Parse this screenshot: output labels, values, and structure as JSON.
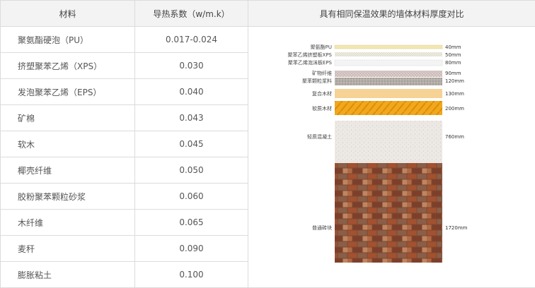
{
  "headers": {
    "material": "材料",
    "conductivity": "导热系数（w/m.k）",
    "comparison": "具有相同保温效果的墙体材料厚度对比"
  },
  "rows": [
    {
      "material": "聚氨酯硬泡（PU）",
      "value": "0.017-0.024"
    },
    {
      "material": "挤塑聚苯乙烯（XPS）",
      "value": "0.030"
    },
    {
      "material": "发泡聚苯乙烯（EPS）",
      "value": "0.040"
    },
    {
      "material": "矿棉",
      "value": "0.043"
    },
    {
      "material": "软木",
      "value": "0.045"
    },
    {
      "material": "椰壳纤维",
      "value": "0.050"
    },
    {
      "material": "胶粉聚苯颗粒砂浆",
      "value": "0.060"
    },
    {
      "material": "木纤维",
      "value": "0.065"
    },
    {
      "material": "麦秆",
      "value": "0.090"
    },
    {
      "material": "膨胀粘土",
      "value": "0.100"
    }
  ],
  "layers": [
    {
      "name": "聚氨酯PU",
      "thickness": "40mm",
      "color": "#f3e6b2"
    },
    {
      "name": "聚苯乙烯挤塑板XPS",
      "thickness": "50mm",
      "color": "#f1efe6"
    },
    {
      "name": "聚苯乙烯泡沫板EPS",
      "thickness": "80mm",
      "color": "#f5f5f5"
    },
    {
      "name": "矿物纤维",
      "thickness": "90mm",
      "color": "#d9cfcc"
    },
    {
      "name": "聚苯颗粒浆料",
      "thickness": "120mm",
      "color": "#b4aea9"
    },
    {
      "name": "复合木材",
      "thickness": "130mm",
      "color": "#f5cf8e"
    },
    {
      "name": "软质木材",
      "thickness": "200mm",
      "color": "#f0a81c"
    },
    {
      "name": "轻质混凝土",
      "thickness": "760mm",
      "color": "#ece8e4"
    },
    {
      "name": "普通砖块",
      "thickness": "1720mm",
      "color": "#9a4e30"
    }
  ]
}
